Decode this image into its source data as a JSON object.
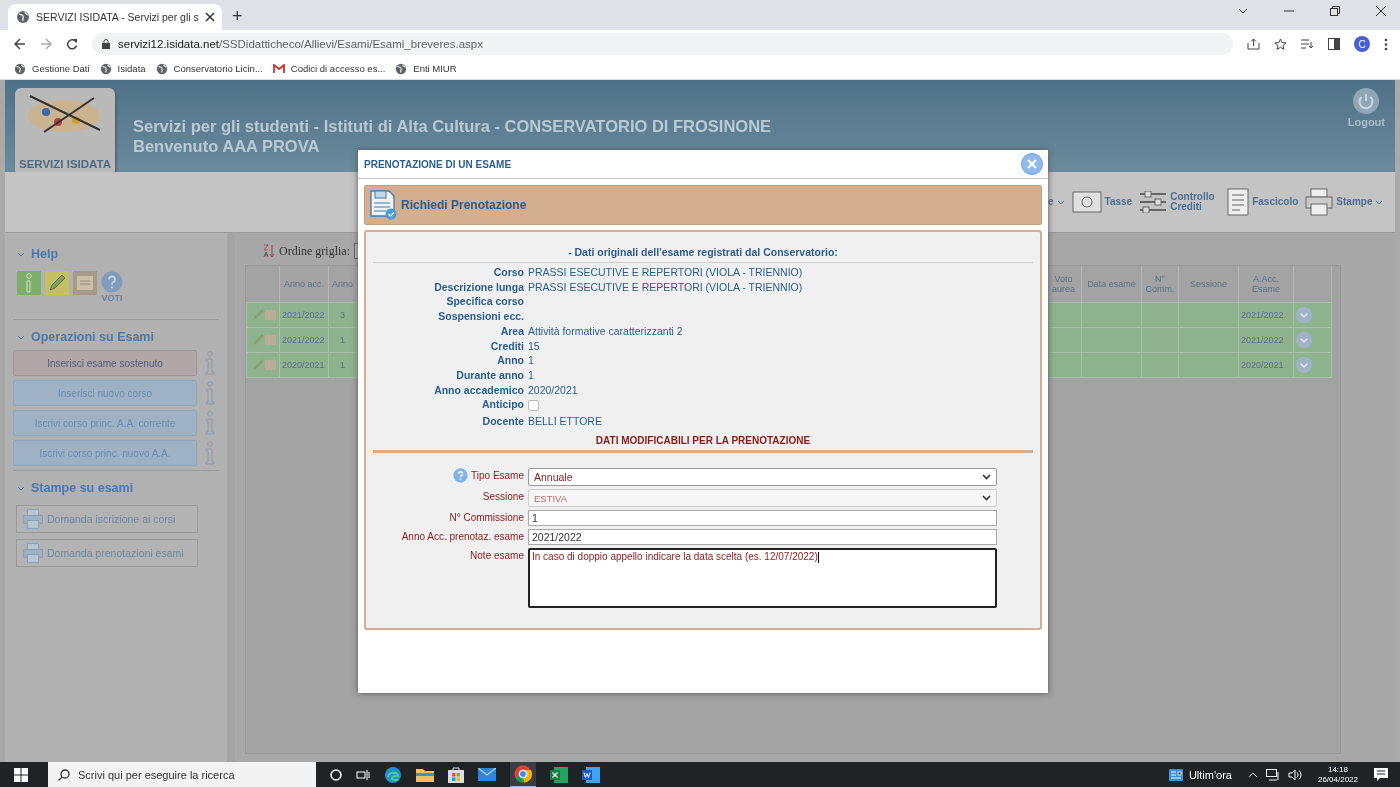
{
  "browser": {
    "tab_title": "SERVIZI ISIDATA - Servizi per gli s",
    "new_tab": "+",
    "url_host": "servizi12.isidata.net",
    "url_path": "/SSDidatticheco/Allievi/Esami/Esami_breveres.aspx",
    "profile_initial": "C",
    "bookmarks": [
      {
        "label": "Gestione Dati",
        "kind": "globe"
      },
      {
        "label": "Isidata",
        "kind": "globe"
      },
      {
        "label": "Conservatorio Licin...",
        "kind": "globe"
      },
      {
        "label": "Codici di accesso es...",
        "kind": "mail"
      },
      {
        "label": "Enti MIUR",
        "kind": "globe"
      }
    ]
  },
  "header": {
    "logo_label": "SERVIZI ISIDATA",
    "title": "Servizi per gli studenti - Istituti di Alta Cultura - CONSERVATORIO DI FROSINONE",
    "welcome": "Benvenuto AAA PROVA",
    "logout": "Logout"
  },
  "toolbar": [
    {
      "label": "e",
      "kind": "none",
      "dropdown": true
    },
    {
      "label": "Tasse",
      "kind": "scanner",
      "dropdown": false
    },
    {
      "label": "Controllo Crediti",
      "kind": "sliders",
      "dropdown": false
    },
    {
      "label": "Fascicolo",
      "kind": "document",
      "dropdown": false
    },
    {
      "label": "Stampe",
      "kind": "printer",
      "dropdown": true
    }
  ],
  "sidebar": {
    "help": {
      "title": "Help",
      "voti": "VOTI"
    },
    "operations": {
      "title": "Operazioni su Esami",
      "buttons": [
        {
          "label": "Inserisci esame sostenuto",
          "disabled": true
        },
        {
          "label": "Inserisci nuovo corso",
          "disabled": false
        },
        {
          "label": "Iscrivi corso princ. A.A. corrente",
          "disabled": false
        },
        {
          "label": "Iscrivi corso princ. nuovo A.A.",
          "disabled": false
        }
      ]
    },
    "prints": {
      "title": "Stampe su esami",
      "buttons": [
        "Domanda iscrizione ai corsi",
        "Domanda prenotazioni esami"
      ]
    }
  },
  "grid": {
    "order_label": "Ordine griglia:",
    "columns_left": [
      "Anno acc.",
      "Anno"
    ],
    "columns_right": [
      "Voto aurea",
      "Data esame",
      "N° Comm.",
      "Sessione",
      "A.Acc. Esame"
    ],
    "rows": [
      {
        "anno_acc": "2021/2022",
        "anno": "3",
        "aacc_esame": "2021/2022"
      },
      {
        "anno_acc": "2021/2022",
        "anno": "1",
        "aacc_esame": "2021/2022"
      },
      {
        "anno_acc": "2020/2021",
        "anno": "1",
        "aacc_esame": "2020/2021"
      }
    ]
  },
  "dialog": {
    "title": "PRENOTAZIONE DI UN ESAME",
    "section": "Richiedi Prenotazione",
    "original_heading": "- Dati originali dell'esame registrati dal Conservatorio:",
    "fields": [
      {
        "label": "Corso",
        "kind": "text",
        "value": "PRASSI ESECUTIVE E REPERTORI (VIOLA - TRIENNIO)"
      },
      {
        "label": "Descrizione lunga",
        "kind": "text",
        "value": "PRASSI ESECUTIVE E REPERTORI (VIOLA - TRIENNIO)"
      },
      {
        "label": "Specifica corso",
        "kind": "text"
      },
      {
        "label": "Sospensioni ecc.",
        "kind": "text"
      },
      {
        "label": "Area",
        "kind": "text",
        "value": "Attività formative caratterizzanti 2"
      },
      {
        "label": "Crediti",
        "kind": "text",
        "value": "15"
      },
      {
        "label": "Anno",
        "kind": "text",
        "value": "1"
      },
      {
        "label": "Durante anno",
        "kind": "text",
        "value": "1"
      },
      {
        "label": "Anno accademico",
        "kind": "text",
        "value": "2020/2021"
      },
      {
        "label": "Anticipo",
        "kind": "checkbox",
        "checked": false
      },
      {
        "label": "Docente",
        "kind": "text",
        "value": "BELLI ETTORE"
      }
    ],
    "editable_heading": "DATI MODIFICABILI PER LA PRENOTAZIONE",
    "form": [
      {
        "label": "Tipo Esame",
        "kind": "select",
        "value": "Annuale",
        "disabled": false,
        "help": true
      },
      {
        "label": "Sessione",
        "kind": "select",
        "value": "ESTIVA",
        "disabled": true,
        "help": false
      },
      {
        "label": "N° Commissione",
        "kind": "input",
        "value": "1",
        "disabled": false,
        "help": false
      },
      {
        "label": "Anno Acc. prenotaz. esame",
        "kind": "input",
        "value": "2021/2022",
        "disabled": false,
        "help": false
      },
      {
        "label": "Note esame",
        "kind": "textarea",
        "value": "In caso di doppio appello indicare la data scelta (es. 12/07/2022)",
        "disabled": false,
        "help": false
      }
    ]
  },
  "taskbar": {
    "search_placeholder": "Scrivi qui per eseguire la ricerca",
    "news": "Ultim'ora",
    "time": "14:18",
    "date": "26/04/2022"
  }
}
